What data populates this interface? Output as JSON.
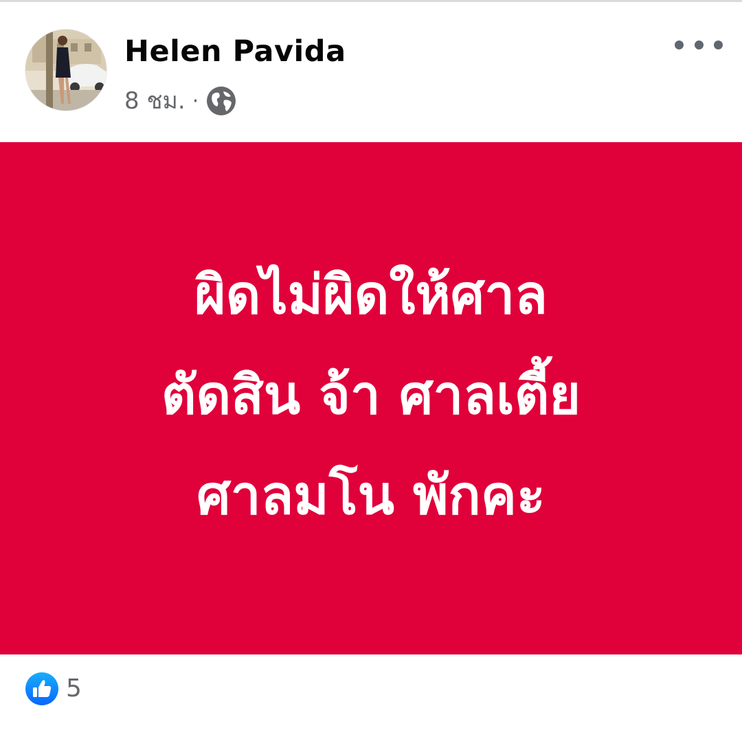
{
  "post": {
    "author": "Helen Pavida",
    "time": "8 ชม.",
    "separator": "·",
    "privacy_icon": "globe-icon",
    "menu_icon": "more-horizontal-icon",
    "image": {
      "background_color": "#e0003a",
      "text_color": "#ffffff",
      "lines": [
        "ผิดไม่ผิดให้ศาล",
        "ตัดสิน จ้า ศาลเตี้ย",
        "ศาลมโน พักคะ"
      ]
    },
    "reactions": {
      "icon": "like-icon",
      "count": "5"
    }
  }
}
